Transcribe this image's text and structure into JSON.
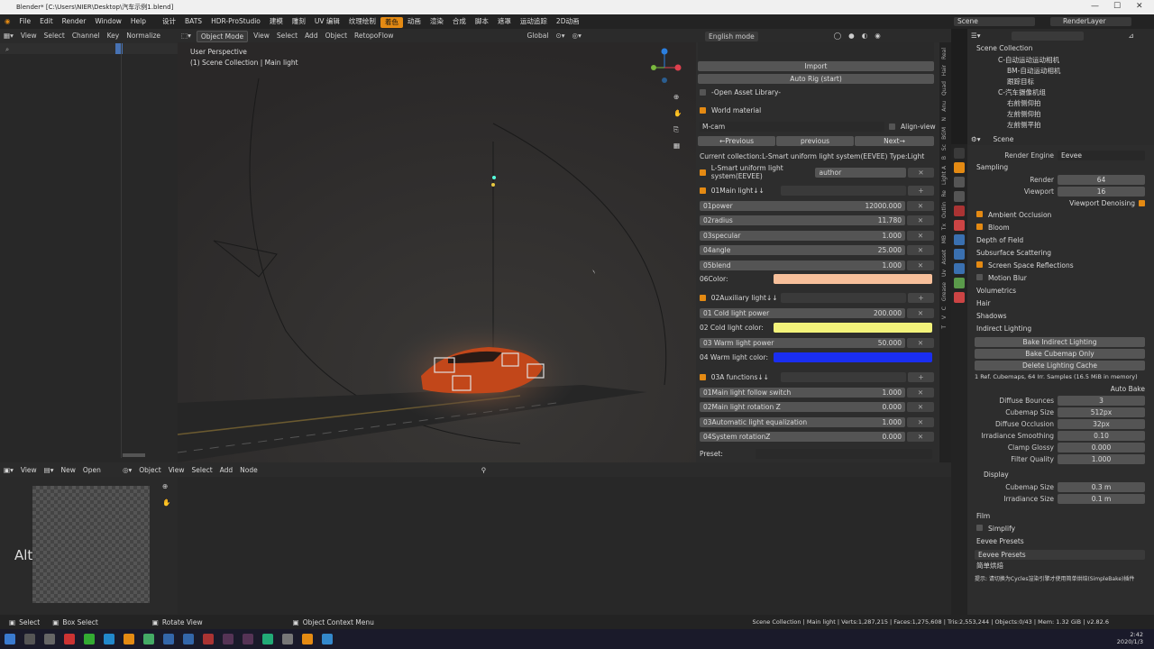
{
  "window": {
    "title": "Blender* [C:\\Users\\NIER\\Desktop\\汽车示例1.blend]"
  },
  "menu": [
    "File",
    "Edit",
    "Render",
    "Window",
    "Help"
  ],
  "workspaces": [
    "设计",
    "BATS",
    "HDR-ProStudio",
    "建模",
    "雕刻",
    "UV 编辑",
    "纹理绘制",
    "着色",
    "动画",
    "渲染",
    "合成",
    "脚本",
    "遮罩",
    "运动追踪",
    "2D动画"
  ],
  "active_workspace": "着色",
  "scene": {
    "name": "Scene",
    "layer": "RenderLayer"
  },
  "left_header": [
    "View",
    "Select",
    "Channel",
    "Key"
  ],
  "normalize": "Normalize",
  "viewport_header": {
    "mode": "Object Mode",
    "items": [
      "View",
      "Select",
      "Add",
      "Object",
      "RetopoFlow"
    ],
    "orient": "Global"
  },
  "viewport": {
    "perspective": "User Perspective",
    "collection": "(1) Scene Collection | Main light"
  },
  "npanel": {
    "english": "English mode",
    "import": "Import",
    "auto_rig": "Auto Rig (start)",
    "open_asset": "-Open Asset Library-",
    "world_material": "World material",
    "mcam": "M-cam",
    "align_view": "Align-view",
    "prev": "←Previous",
    "previous": "previous",
    "next": "Next→",
    "current": "Current collection:L-Smart uniform light system(EEVEE)  Type:Light",
    "system": "L-Smart uniform light system(EEVEE)",
    "author": "author",
    "main_light": "01Main light↓↓",
    "main_rows": [
      {
        "label": "01power",
        "value": "12000.000"
      },
      {
        "label": "02radius",
        "value": "11.780"
      },
      {
        "label": "03specular",
        "value": "1.000"
      },
      {
        "label": "04angle",
        "value": "25.000"
      },
      {
        "label": "05blend",
        "value": "1.000"
      }
    ],
    "color_label": "06Color:",
    "aux_light": "02Auxiliary light↓↓",
    "cold_power": "01 Cold light power",
    "cold_power_val": "200.000",
    "cold_color": "02 Cold light color:",
    "warm_power": "03 Warm light power",
    "warm_power_val": "50.000",
    "warm_color": "04 Warm light color:",
    "functions": "03A functions↓↓",
    "func_rows": [
      {
        "label": "01Main light follow switch",
        "value": "1.000"
      },
      {
        "label": "02Main light rotation Z",
        "value": "0.000"
      },
      {
        "label": "03Automatic light equalization",
        "value": "1.000"
      },
      {
        "label": "04System rotationZ",
        "value": "0.000"
      }
    ],
    "preset": "Preset:",
    "colors": {
      "main": "#f7bf9a",
      "cold": "#f2f27a",
      "warm": "#1a2ef0"
    }
  },
  "npanel_tabs": [
    "Real",
    "Hair",
    "Quad",
    "Anu",
    "N",
    "BGM",
    "Sc",
    "B",
    "Light A",
    "Re",
    "Outlin",
    "Tx",
    "MB",
    "Asset",
    "Uv",
    "Grease",
    "C",
    "V",
    "T"
  ],
  "bottom_header": {
    "view": "View",
    "new": "New",
    "open": "Open",
    "object": "Object",
    "items": [
      "View",
      "Select",
      "Add",
      "Node"
    ]
  },
  "alt_key": "Alt",
  "outliner": {
    "root": "Scene Collection",
    "items": [
      "C-自动运动运动相机",
      "BM-自动运动相机",
      "跟踪目标",
      "C-汽车摄像机组",
      "右前侧仰拍",
      "左前侧仰拍",
      "左前侧平拍"
    ]
  },
  "props": {
    "scene": "Scene",
    "render_engine_label": "Render Engine",
    "render_engine": "Eevee",
    "sampling": "Sampling",
    "render_label": "Render",
    "render_val": "64",
    "viewport_label": "Viewport",
    "viewport_val": "16",
    "denoise": "Viewport Denoising",
    "sections": [
      "Ambient Occlusion",
      "Bloom",
      "Depth of Field",
      "Subsurface Scattering",
      "Screen Space Reflections",
      "Motion Blur",
      "Volumetrics",
      "Hair",
      "Shadows",
      "Indirect Lighting"
    ],
    "bake_indirect": "Bake Indirect Lighting",
    "bake_cubemap": "Bake Cubemap Only",
    "delete_cache": "Delete Lighting Cache",
    "cache_info": "1 Ref. Cubemaps, 64 Irr. Samples (16.5 MiB in memory)",
    "auto_bake": "Auto Bake",
    "il_rows": [
      {
        "label": "Diffuse Bounces",
        "value": "3"
      },
      {
        "label": "Cubemap Size",
        "value": "512px"
      },
      {
        "label": "Diffuse Occlusion",
        "value": "32px"
      },
      {
        "label": "Irradiance Smoothing",
        "value": "0.10"
      },
      {
        "label": "Clamp Glossy",
        "value": "0.000"
      },
      {
        "label": "Filter Quality",
        "value": "1.000"
      }
    ],
    "display": "Display",
    "display_rows": [
      {
        "label": "Cubemap Size",
        "value": "0.3 m"
      },
      {
        "label": "Irradiance Size",
        "value": "0.1 m"
      }
    ],
    "film": "Film",
    "simplify": "Simplify",
    "eevee_presets": "Eevee Presets",
    "eevee_presets_box": "Eevee Presets",
    "simple_bake": "简单烘焙",
    "bake_note": "提示: 请切换为Cycles渲染引擎才使用简单烘焙(SimpleBake)插件"
  },
  "status": {
    "select": "Select",
    "box_select": "Box Select",
    "rotate": "Rotate View",
    "context": "Object Context Menu",
    "info": "Scene Collection | Main light | Verts:1,287,215 | Faces:1,275,608 | Tris:2,553,244 | Objects:0/43 | Mem: 1.32 GiB | v2.82.6"
  },
  "clock": {
    "time": "2:42",
    "date": "2020/1/3"
  }
}
